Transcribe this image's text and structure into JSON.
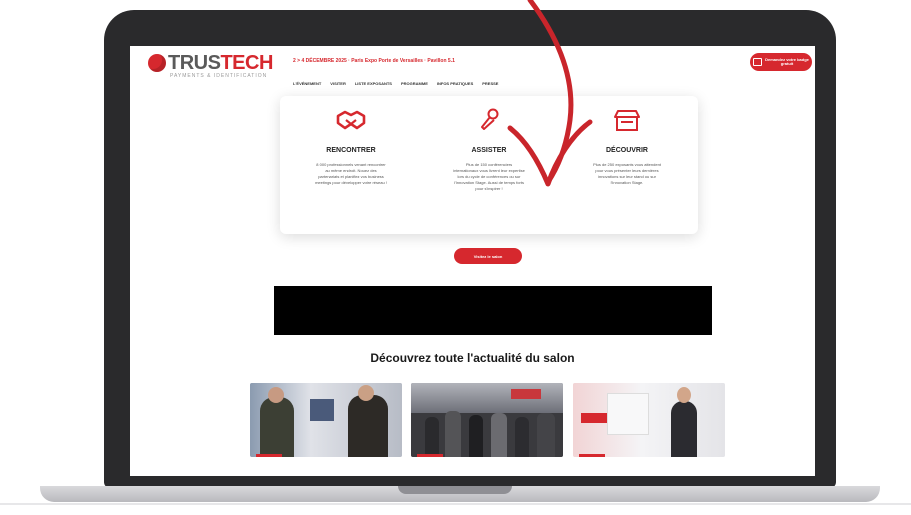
{
  "site": {
    "logo_main": "TRUS",
    "logo_accent": "TECH",
    "logo_tagline": "PAYMENTS & IDENTIFICATION",
    "event_date": "2 > 4 DÉCEMBRE 2025 · Paris Expo Porte de Versailles · Pavillon 5.1",
    "cta_top": "Demandez votre badge gratuit",
    "nav": [
      "L'ÉVÉNEMENT",
      "VISITER",
      "LISTE EXPOSANTS",
      "PROGRAMME",
      "INFOS PRATIQUES",
      "PRESSE"
    ]
  },
  "cards": [
    {
      "title": "RENCONTRER",
      "icon": "handshake-icon",
      "desc": "8 000 professionnels venant rencontrer au même endroit. Nouez des partenariats et planifiez vos business meetings pour développer votre réseau !"
    },
    {
      "title": "ASSISTER",
      "icon": "microphone-icon",
      "desc": "Plus de 150 conférenciers internationaux vous livrent leur expertise lors du cycle de conférences ou sur l'Innovation Stage. Aussi de temps forts pour s'inspirer !"
    },
    {
      "title": "DÉCOUVRIR",
      "icon": "storefront-icon",
      "desc": "Plus de 250 exposants vous attendent pour vous présenter leurs dernières innovations sur leur stand ou sur l'Innovation Stage."
    }
  ],
  "cta_main": "Visitez le salon",
  "news": {
    "heading": "Découvrez toute l'actualité du salon"
  },
  "colors": {
    "accent": "#d6282e",
    "frame": "#2a2a2c"
  }
}
